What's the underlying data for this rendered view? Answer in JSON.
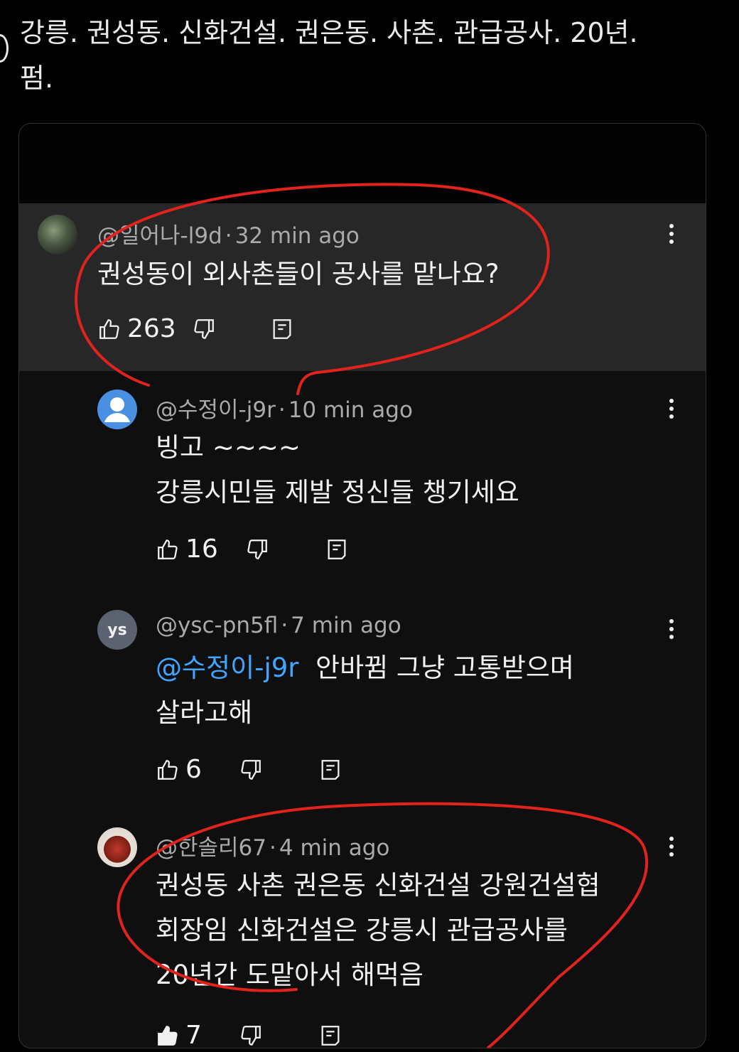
{
  "post": {
    "text_line1": "강릉. 권성동. 신화건설. 권은동. 사촌. 관급공사. 20년.",
    "text_line2": "펌."
  },
  "comments": [
    {
      "author": "@일어나-l9d",
      "time": "32 min ago",
      "lines": [
        "권성동이 외사촌들이 공사를 맡나요?"
      ],
      "likes": "263",
      "avatar": "photo"
    },
    {
      "author": "@수정이-j9r",
      "time": "10 min ago",
      "lines": [
        "빙고  ~~~~",
        "강릉시민들 제발 정신들  챙기세요"
      ],
      "likes": "16",
      "avatar": "default-person"
    },
    {
      "author": "@ysc-pn5fl",
      "time": "7 min ago",
      "mention": "@수정이-j9r",
      "lines": [
        "안바뀜 그냥 고통받으며",
        "살라고해"
      ],
      "likes": "6",
      "avatar_initials": "ys"
    },
    {
      "author": "@한솔리67",
      "time": "4 min ago",
      "lines": [
        "권성동 사촌 권은동 신화건설 강원건설협",
        "회장임 신화건설은 강릉시 관급공사를",
        "20년간 도맡아서 해먹음"
      ],
      "likes": "7",
      "avatar": "photo"
    }
  ],
  "icons": {
    "like": "thumbs-up-icon",
    "dislike": "thumbs-down-icon",
    "reply": "reply-icon",
    "more": "more-vertical-icon"
  },
  "colors": {
    "background": "#000000",
    "card": "#0f0f0f",
    "highlight": "#272727",
    "mention": "#3ea6ff",
    "annotation": "#e0231c"
  }
}
